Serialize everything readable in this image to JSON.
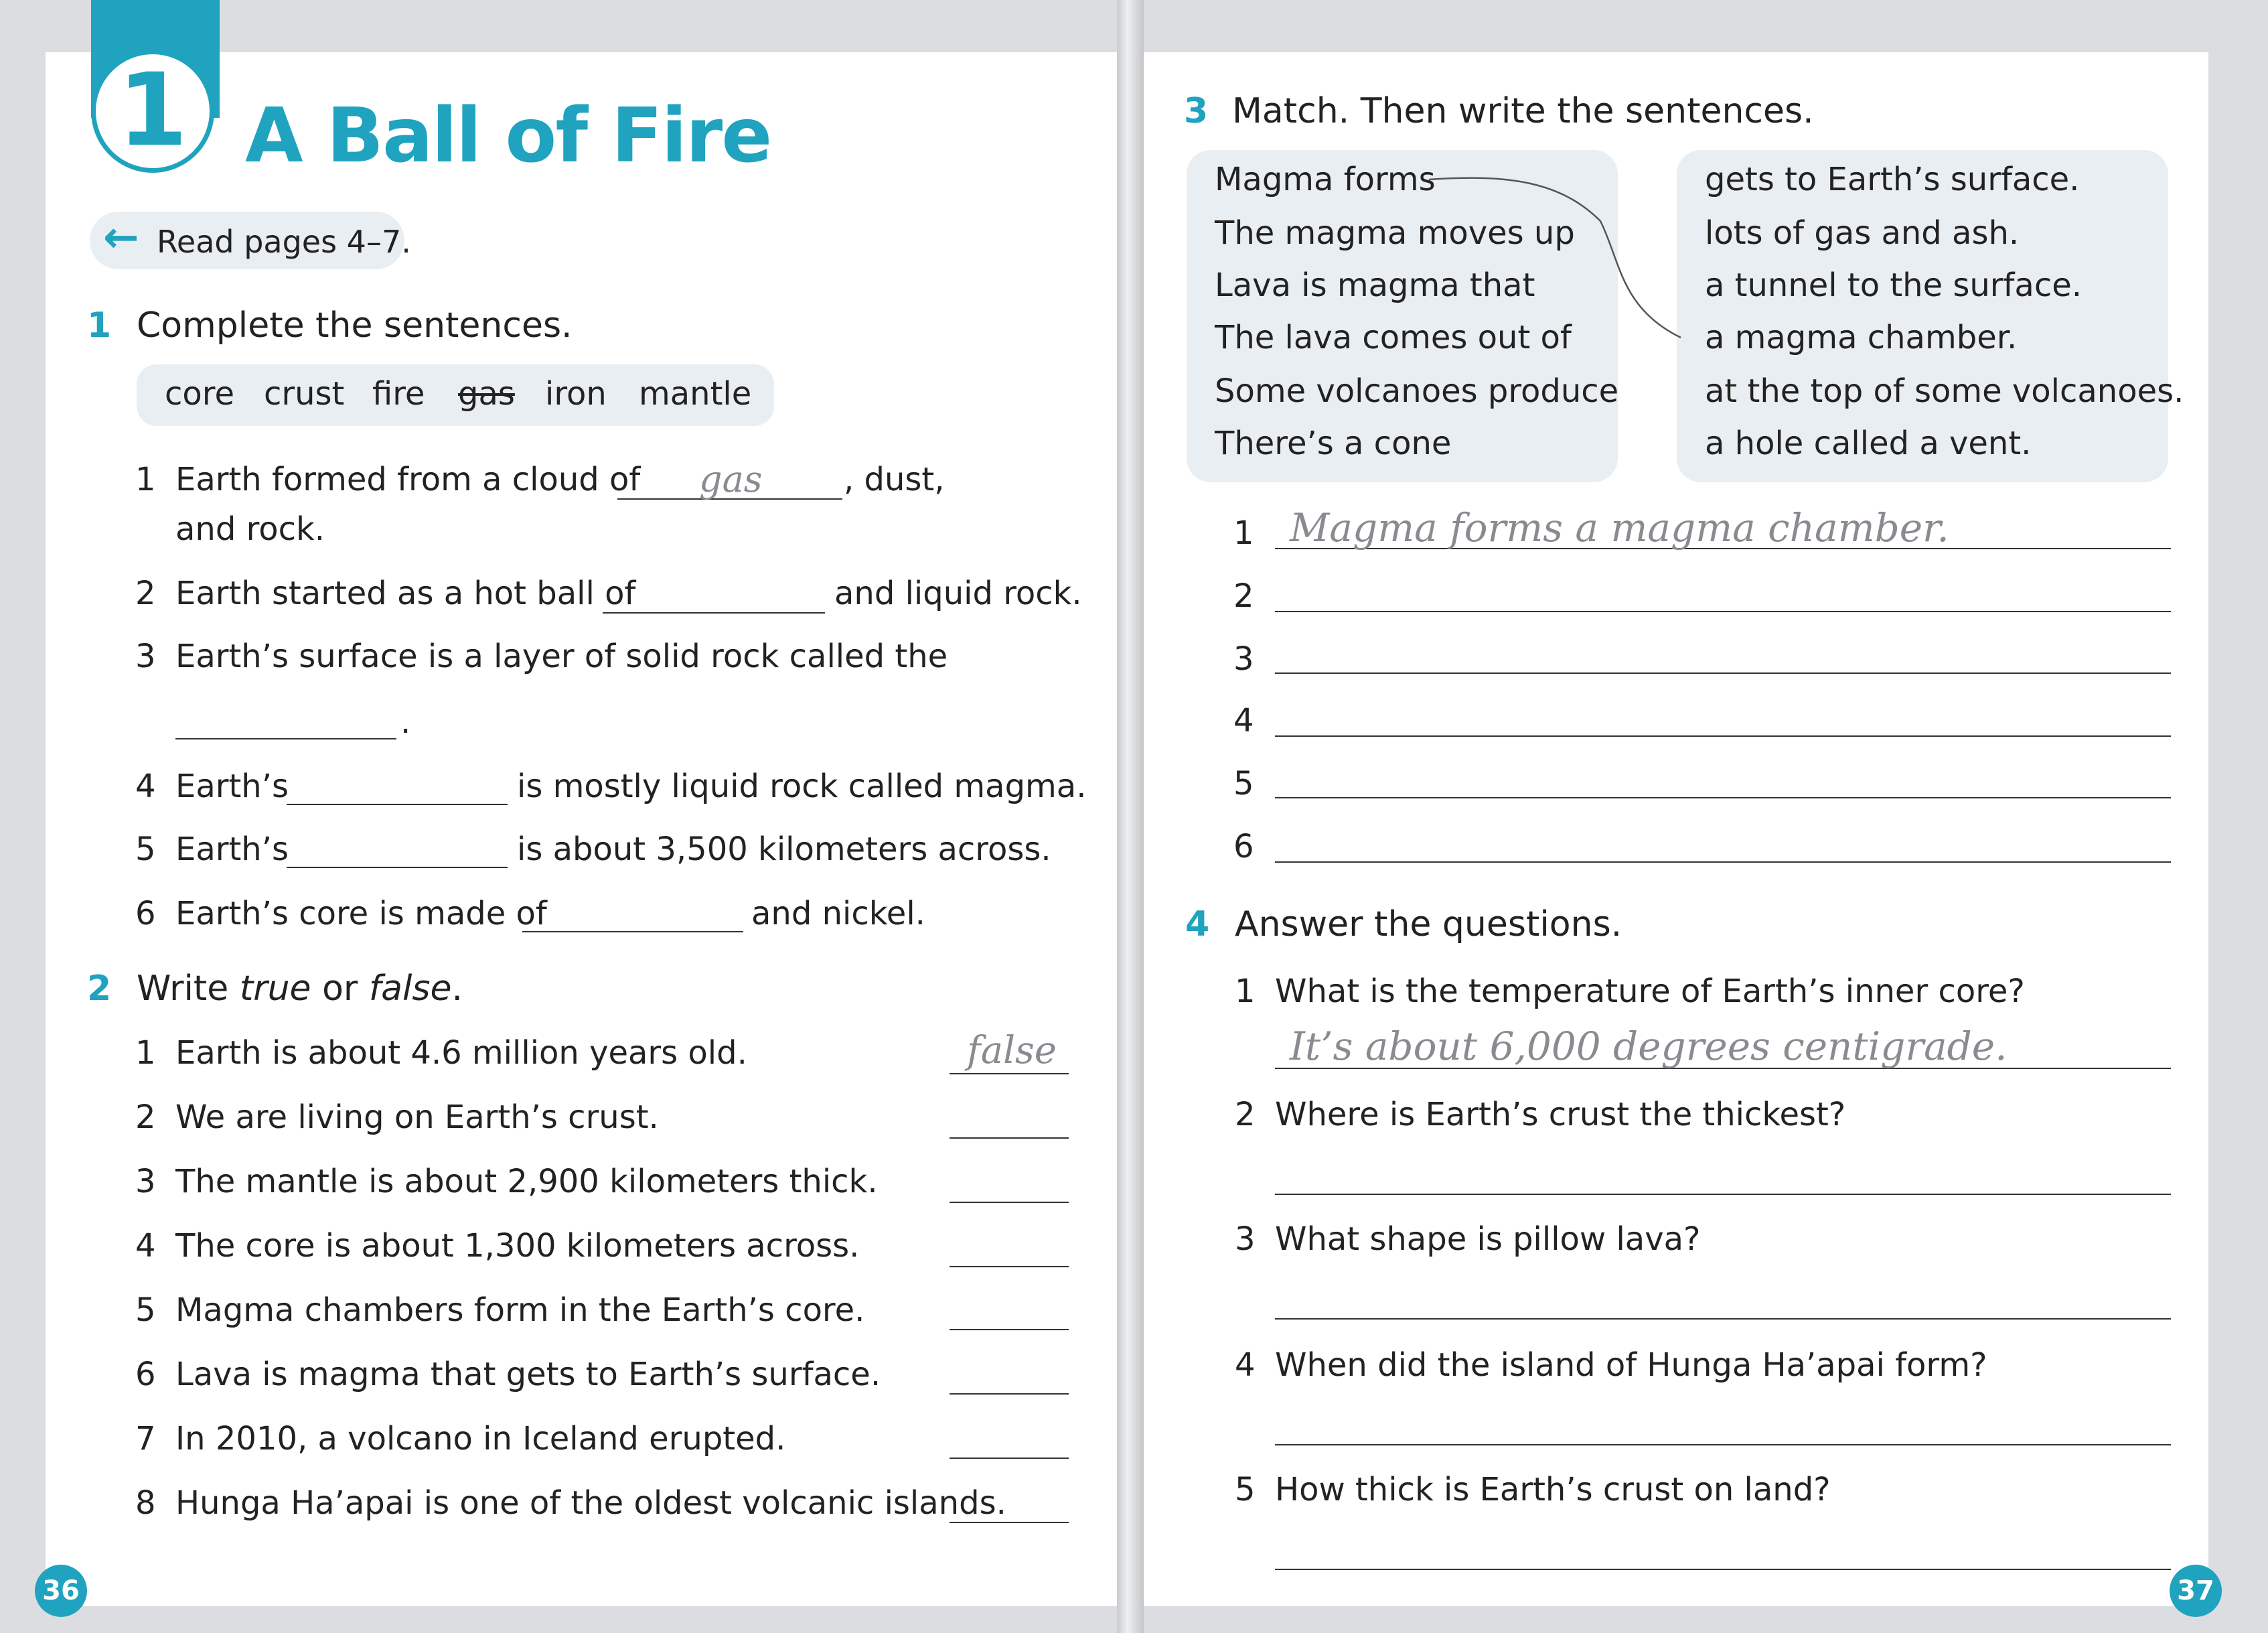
{
  "left": {
    "unit_number": "1",
    "unit_title": "A Ball of Fire",
    "read_pages": "Read pages 4–7.",
    "ex1": {
      "number": "1",
      "title": "Complete the sentences.",
      "words": [
        "core",
        "crust",
        "fire",
        "gas",
        "iron",
        "mantle"
      ],
      "items": [
        {
          "n": "1",
          "a": "Earth formed from a cloud of",
          "b": ", dust,",
          "c": "and rock.",
          "answer": "gas"
        },
        {
          "n": "2",
          "a": "Earth started as a hot ball of",
          "b": "and liquid rock."
        },
        {
          "n": "3",
          "a": "Earth’s surface is a layer of solid rock called the",
          "b": "."
        },
        {
          "n": "4",
          "a": "Earth’s",
          "b": "is mostly liquid rock called magma."
        },
        {
          "n": "5",
          "a": "Earth’s",
          "b": "is about 3,500 kilometers across."
        },
        {
          "n": "6",
          "a": "Earth’s core is made of",
          "b": "and nickel."
        }
      ]
    },
    "ex2": {
      "number": "2",
      "title_pre": "Write ",
      "title_true": "true",
      "title_mid": " or ",
      "title_false": "false",
      "title_end": ".",
      "items": [
        {
          "n": "1",
          "text": "Earth is about 4.6 million years old.",
          "answer": "false"
        },
        {
          "n": "2",
          "text": "We are living on Earth’s crust."
        },
        {
          "n": "3",
          "text": "The mantle is about 2,900 kilometers thick."
        },
        {
          "n": "4",
          "text": "The core is about 1,300 kilometers across."
        },
        {
          "n": "5",
          "text": "Magma chambers form in the Earth’s core."
        },
        {
          "n": "6",
          "text": "Lava is magma that gets to Earth’s surface."
        },
        {
          "n": "7",
          "text": "In 2010, a volcano in Iceland erupted."
        },
        {
          "n": "8",
          "text": "Hunga Ha’apai is one of the oldest volcanic islands."
        }
      ]
    },
    "page_number": "36"
  },
  "right": {
    "ex3": {
      "number": "3",
      "title": "Match. Then write the sentences.",
      "left_items": [
        "Magma forms",
        "The magma moves up",
        "Lava is magma that",
        "The lava comes out of",
        "Some volcanoes produce",
        "There’s a cone"
      ],
      "right_items": [
        "gets to Earth’s surface.",
        "lots of gas and ash.",
        "a tunnel to the surface.",
        "a magma chamber.",
        "at the top of some volcanoes.",
        "a hole called a vent."
      ],
      "lines": [
        {
          "n": "1",
          "answer": "Magma forms a magma chamber."
        },
        {
          "n": "2"
        },
        {
          "n": "3"
        },
        {
          "n": "4"
        },
        {
          "n": "5"
        },
        {
          "n": "6"
        }
      ]
    },
    "ex4": {
      "number": "4",
      "title": "Answer the questions.",
      "items": [
        {
          "n": "1",
          "q": "What is the temperature of Earth’s inner core?",
          "answer": "It’s about 6,000 degrees centigrade."
        },
        {
          "n": "2",
          "q": "Where is Earth’s crust the thickest?"
        },
        {
          "n": "3",
          "q": "What shape is pillow lava?"
        },
        {
          "n": "4",
          "q": "When did the island of Hunga Ha’apai form?"
        },
        {
          "n": "5",
          "q": "How thick is Earth’s crust on land?"
        }
      ]
    },
    "page_number": "37"
  }
}
